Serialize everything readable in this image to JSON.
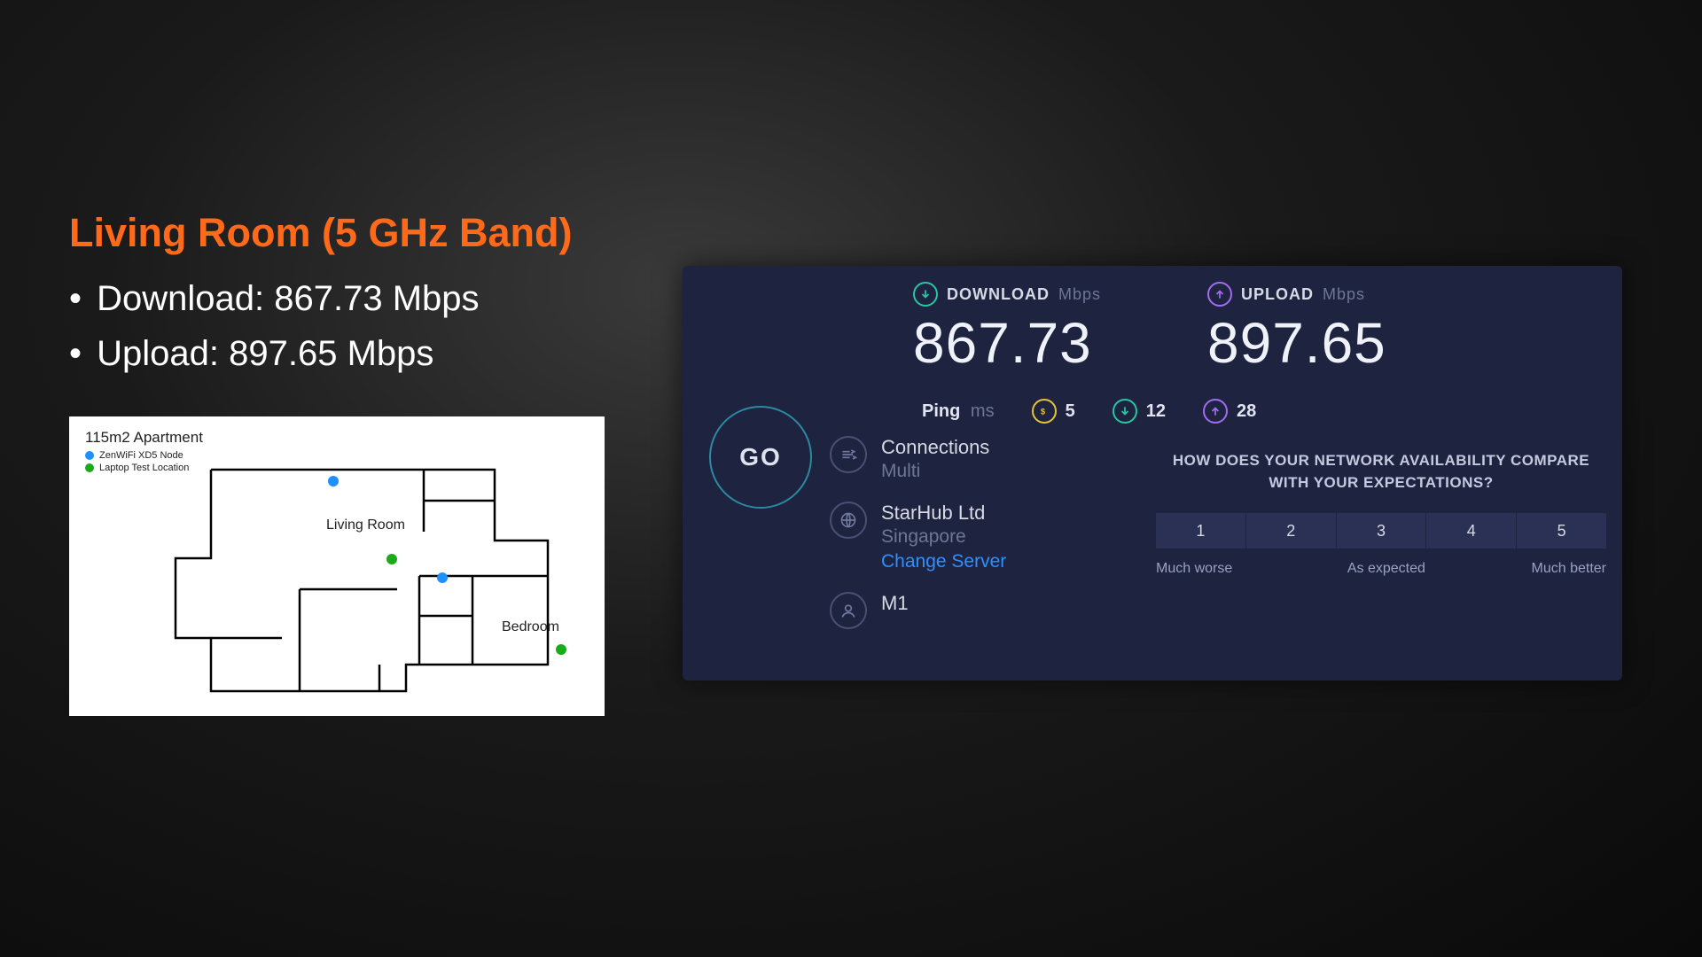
{
  "left": {
    "title": "Living Room (5 GHz Band)",
    "download_line": "Download: 867.73 Mbps",
    "upload_line": "Upload: 897.65 Mbps"
  },
  "floorplan": {
    "title": "115m2 Apartment",
    "legend_node": "ZenWiFi XD5 Node",
    "legend_test": "Laptop Test Location",
    "room_living": "Living Room",
    "room_bedroom": "Bedroom"
  },
  "speedtest": {
    "download_label": "DOWNLOAD",
    "upload_label": "UPLOAD",
    "unit": "Mbps",
    "download_value": "867.73",
    "upload_value": "897.65",
    "ping_label": "Ping",
    "ping_unit": "ms",
    "ping_idle": "5",
    "ping_dl": "12",
    "ping_ul": "28",
    "go": "GO",
    "connections_label": "Connections",
    "connections_value": "Multi",
    "server_name": "StarHub Ltd",
    "server_loc": "Singapore",
    "change_server": "Change Server",
    "isp": "M1",
    "survey_q": "HOW DOES YOUR NETWORK AVAILABILITY COMPARE WITH YOUR EXPECTATIONS?",
    "scale": {
      "s1": "1",
      "s2": "2",
      "s3": "3",
      "s4": "4",
      "s5": "5"
    },
    "scale_labels": {
      "low": "Much worse",
      "mid": "As expected",
      "high": "Much better"
    }
  }
}
